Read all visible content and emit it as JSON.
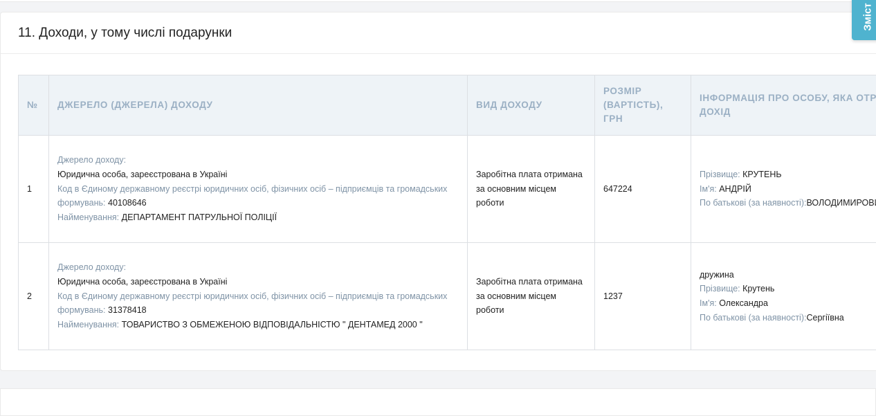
{
  "section": {
    "title": "11. Доходи, у тому числі подарунки"
  },
  "side_tab": {
    "label": "Зміст"
  },
  "table": {
    "headers": {
      "num": "№",
      "source": "Джерело (джерела) доходу",
      "type": "Вид доходу",
      "amount": "Розмір (вартість), грн",
      "person": "Інформація про особу, яка отримала дохід"
    },
    "rows": [
      {
        "num": "1",
        "source_label": "Джерело доходу:",
        "source_value": "Юридична особа, зареєстрована в Україні",
        "code_label": "Код в Єдиному державному реєстрі юридичних осіб, фізичних осіб – підприємців та громадських формувань:",
        "code_value": "40108646",
        "name_label": "Найменування:",
        "name_value": "ДЕПАРТАМЕНТ ПАТРУЛЬНОЇ ПОЛІЦІЇ",
        "income_type": "Заробітна плата отримана за основним місцем роботи",
        "amount": "647224",
        "relation": "",
        "surname_label": "Прізвище:",
        "surname": "КРУТЕНЬ",
        "firstname_label": "Ім'я:",
        "firstname": "АНДРІЙ",
        "patronymic_label": "По батькові (за наявності):",
        "patronymic": "ВОЛОДИМИРОВИЧ"
      },
      {
        "num": "2",
        "source_label": "Джерело доходу:",
        "source_value": "Юридична особа, зареєстрована в Україні",
        "code_label": "Код в Єдиному державному реєстрі юридичних осіб, фізичних осіб – підприємців та громадських формувань:",
        "code_value": "31378418",
        "name_label": "Найменування:",
        "name_value": "ТОВАРИСТВО З ОБМЕЖЕНОЮ ВІДПОВІДАЛЬНІСТЮ \" ДЕНТАМЕД 2000 \"",
        "income_type": "Заробітна плата отримана за основним місцем роботи",
        "amount": "1237",
        "relation": "дружина",
        "surname_label": "Прізвище:",
        "surname": "Крутень",
        "firstname_label": "Ім'я:",
        "firstname": "Олександра",
        "patronymic_label": "По батькові (за наявності):",
        "patronymic": "Сергіївна"
      }
    ]
  }
}
